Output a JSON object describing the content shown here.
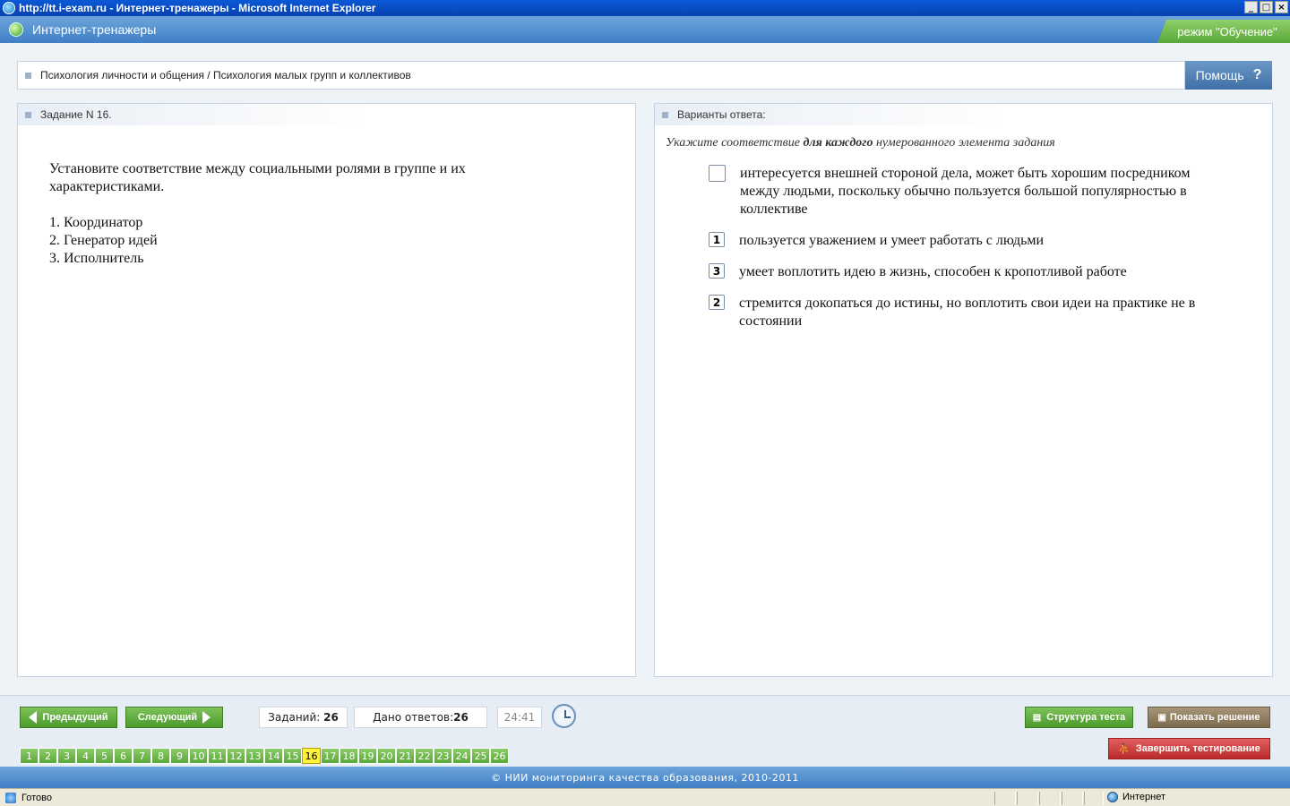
{
  "window": {
    "title": "http://tt.i-exam.ru - Интернет-тренажеры - Microsoft Internet Explorer",
    "min": "_",
    "max": "□",
    "close": "×"
  },
  "app": {
    "title": "Интернет-тренажеры",
    "mode": "режим \"Обучение\""
  },
  "breadcrumb": "Психология личности и общения / Психология малых групп и коллективов",
  "help_label": "Помощь",
  "help_icon": "?",
  "task": {
    "header": "Задание N 16.",
    "text": "Установите соответствие между социальными ролями в группе и их характеристиками.",
    "items": [
      "1. Координатор",
      "2. Генератор идей",
      "3. Исполнитель"
    ]
  },
  "answers": {
    "header": "Варианты ответа:",
    "instruction_pre": "Укажите соответствие ",
    "instruction_bold": "для каждого",
    "instruction_post": " нумерованного элемента задания",
    "options": [
      {
        "value": "",
        "text": "интересуется внешней стороной дела, может быть хорошим посредником между людьми, поскольку обычно пользуется большой популярностью в коллективе"
      },
      {
        "value": "1",
        "text": "пользуется уважением и умеет работать с людьми"
      },
      {
        "value": "3",
        "text": "умеет воплотить идею в жизнь, способен к кропотливой работе"
      },
      {
        "value": "2",
        "text": "стремится докопаться до истины, но воплотить свои идеи на практике не в состоянии"
      }
    ]
  },
  "toolbar": {
    "prev_label": "Предыдущий",
    "next_label": "Следующий",
    "tasks_label": "Заданий:",
    "tasks_count": "26",
    "answers_label": "Дано ответов:",
    "answers_count": "26",
    "timer": "24:41",
    "structure_label": "Структура теста",
    "solution_label": "Показать решение",
    "finish_label": "Завершить тестирование"
  },
  "pager": {
    "pages": [
      "1",
      "2",
      "3",
      "4",
      "5",
      "6",
      "7",
      "8",
      "9",
      "10",
      "11",
      "12",
      "13",
      "14",
      "15",
      "16",
      "17",
      "18",
      "19",
      "20",
      "21",
      "22",
      "23",
      "24",
      "25",
      "26"
    ],
    "current": "16"
  },
  "footer": "© НИИ мониторинга качества образования, 2010-2011",
  "status": {
    "text": "Готово",
    "zone": "Интернет"
  }
}
